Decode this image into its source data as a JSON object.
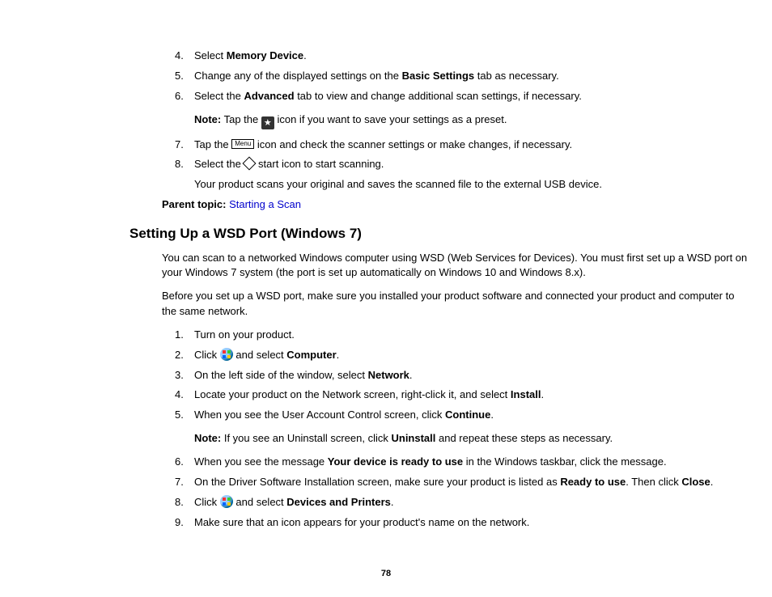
{
  "top_list": {
    "item4": {
      "num": "4.",
      "pre": "Select ",
      "bold": "Memory Device",
      "post": "."
    },
    "item5": {
      "num": "5.",
      "pre": "Change any of the displayed settings on the ",
      "bold": "Basic Settings",
      "post": " tab as necessary."
    },
    "item6": {
      "num": "6.",
      "pre": "Select the ",
      "bold": "Advanced",
      "post": " tab to view and change additional scan settings, if necessary."
    },
    "note": {
      "label": "Note:",
      "pre": " Tap the ",
      "post": " icon if you want to save your settings as a preset."
    },
    "item7": {
      "num": "7.",
      "pre": "Tap the ",
      "post": " icon and check the scanner settings or make changes, if necessary."
    },
    "item8": {
      "num": "8.",
      "pre": "Select the ",
      "post": " start icon to start scanning."
    },
    "item8_sub": "Your product scans your original and saves the scanned file to the external USB device."
  },
  "parent_topic": {
    "label": "Parent topic:",
    "link": "Starting a Scan"
  },
  "heading": "Setting Up a WSD Port (Windows 7)",
  "p1": "You can scan to a networked Windows computer using WSD (Web Services for Devices). You must first set up a WSD port on your Windows 7 system (the port is set up automatically on Windows 10 and Windows 8.x).",
  "p2": "Before you set up a WSD port, make sure you installed your product software and connected your product and computer to the same network.",
  "bottom_list": {
    "item1": {
      "num": "1.",
      "text": "Turn on your product."
    },
    "item2": {
      "num": "2.",
      "pre": "Click ",
      "mid": " and select ",
      "bold": "Computer",
      "post": "."
    },
    "item3": {
      "num": "3.",
      "pre": "On the left side of the window, select ",
      "bold": "Network",
      "post": "."
    },
    "item4": {
      "num": "4.",
      "pre": "Locate your product on the Network screen, right-click it, and select ",
      "bold": "Install",
      "post": "."
    },
    "item5": {
      "num": "5.",
      "pre": "When you see the User Account Control screen, click ",
      "bold": "Continue",
      "post": "."
    },
    "note": {
      "label": "Note:",
      "pre": " If you see an Uninstall screen, click ",
      "bold": "Uninstall",
      "post": " and repeat these steps as necessary."
    },
    "item6": {
      "num": "6.",
      "pre": "When you see the message ",
      "bold": "Your device is ready to use",
      "post": " in the Windows taskbar, click the message."
    },
    "item7": {
      "num": "7.",
      "pre": "On the Driver Software Installation screen, make sure your product is listed as ",
      "bold": "Ready to use",
      "post": ". Then click ",
      "bold2": "Close",
      "post2": "."
    },
    "item8": {
      "num": "8.",
      "pre": "Click ",
      "mid": " and select ",
      "bold": "Devices and Printers",
      "post": "."
    },
    "item9": {
      "num": "9.",
      "text": "Make sure that an icon appears for your product's name on the network."
    }
  },
  "page_number": "78",
  "icons": {
    "menu_label": "Menu",
    "star_glyph": "★"
  }
}
